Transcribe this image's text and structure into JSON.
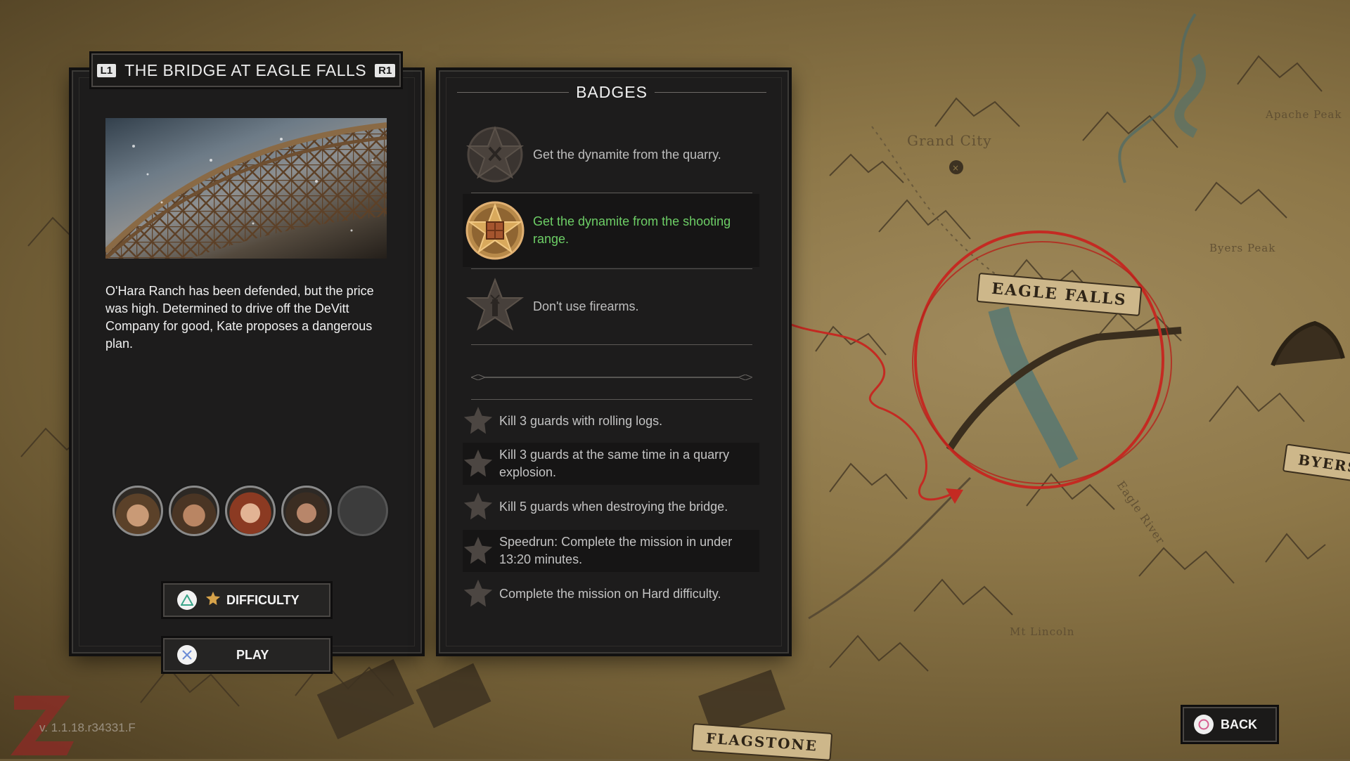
{
  "mission": {
    "prev_tag": "L1",
    "title": "THE BRIDGE AT EAGLE FALLS",
    "next_tag": "R1",
    "description": "O'Hara Ranch has been defended, but the price was high. Determined to drive off the DeVitt Company for good, Kate proposes a dangerous plan."
  },
  "portraits": [
    "cowboy-hat-portrait",
    "bearded-man-portrait",
    "red-haired-woman-portrait",
    "older-bearded-man-portrait",
    "empty-portrait-slot"
  ],
  "buttons": {
    "difficulty_label": "DIFFICULTY",
    "play_label": "PLAY",
    "back_label": "BACK"
  },
  "badges": {
    "title": "BADGES",
    "main": [
      {
        "text": "Get the dynamite from the quarry.",
        "icon": "sheriff-star-badge-icon",
        "state": "locked"
      },
      {
        "text": "Get the dynamite from the shooting range.",
        "icon": "sheriff-star-badge-icon",
        "state": "earned"
      },
      {
        "text": "Don't use firearms.",
        "icon": "sheriff-star-badge-icon",
        "state": "locked"
      }
    ],
    "optional": [
      "Kill 3 guards with rolling logs.",
      "Kill 3 guards at the same time in a quarry explosion.",
      "Kill 5 guards when destroying the bridge.",
      "Speedrun: Complete the mission in under 13:20 minutes.",
      "Complete the mission on Hard difficulty."
    ]
  },
  "map": {
    "labels": [
      "Grand City",
      "Apache Peak",
      "Byers Peak",
      "Mt Lincoln",
      "Eagle River"
    ],
    "banners": [
      "EAGLE FALLS",
      "BYERS",
      "FLAGSTONE"
    ]
  },
  "version": "v. 1.1.18.r34331.F",
  "colors": {
    "panel": "#1d1c1c",
    "earned_text": "#6dce66",
    "route_red": "#c42a22"
  }
}
